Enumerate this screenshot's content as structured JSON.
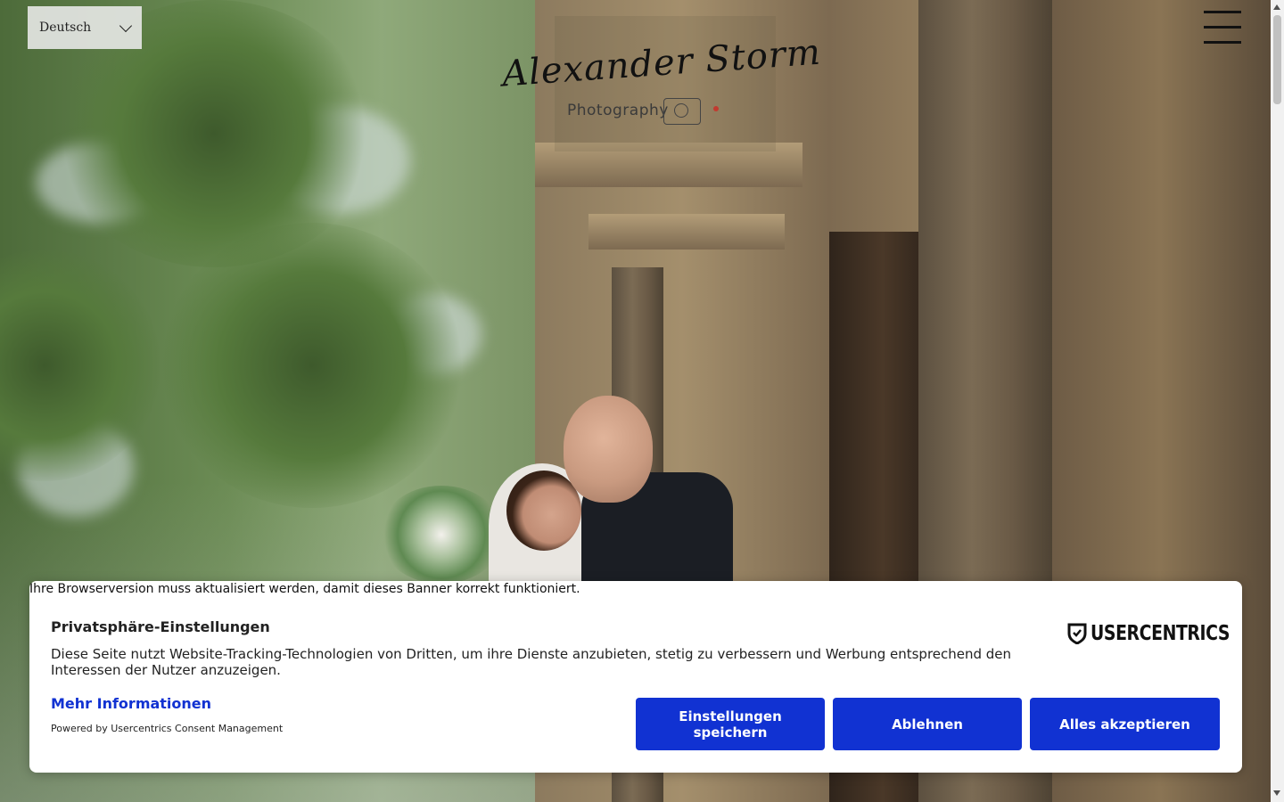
{
  "language_selector": {
    "value": "Deutsch"
  },
  "logo": {
    "script": "Alexander Storm",
    "subtitle": "Photography"
  },
  "hero": {
    "image_alt": "Wedding couple photo"
  },
  "browser_warning": "Ihre Browserversion muss aktualisiert werden, damit dieses Banner korrekt funktioniert.",
  "consent": {
    "title": "Privatsphäre-Einstellungen",
    "text": "Diese Seite nutzt Website-Tracking-Technologien von Dritten, um ihre Dienste anzubieten, stetig zu verbessern und Werbung entsprechend den Interessen der Nutzer anzuzeigen.",
    "more_info": "Mehr Informationen",
    "powered_by": "Powered by Usercentrics Consent Management",
    "brand": "USERCENTRICS",
    "buttons": {
      "settings": "Einstellungen speichern",
      "deny": "Ablehnen",
      "accept": "Alles akzeptieren"
    },
    "accent_color": "#1132d2"
  },
  "icons": [
    "chevron-down-icon",
    "hamburger-menu-icon",
    "camera-icon",
    "usercentrics-shield-icon"
  ]
}
